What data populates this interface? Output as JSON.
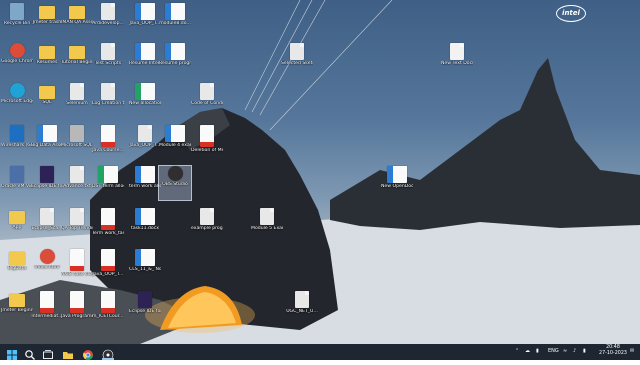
{
  "desktop": {
    "icons": [
      {
        "label": "Recycle Bin",
        "color": "#7fa7c8",
        "kind": "bin"
      },
      {
        "label": "Jmeter trash",
        "color": "#f2c94c",
        "kind": "folder"
      },
      {
        "label": "IMAN QA Assessmen...",
        "color": "#f2c94c",
        "kind": "folder"
      },
      {
        "label": "Ardidevelop...",
        "color": "#e8e8e8",
        "kind": "file"
      },
      {
        "label": "Java_OOP_T...",
        "color": "#2b7cd3",
        "kind": "docx"
      },
      {
        "label": "module8.do...",
        "color": "#2b7cd3",
        "kind": "docx"
      },
      {
        "label": "Google Chrome",
        "color": "#dd4b39",
        "kind": "round"
      },
      {
        "label": "Resumes",
        "color": "#f2c94c",
        "kind": "folder"
      },
      {
        "label": "Tutorial Beginner...",
        "color": "#f2c94c",
        "kind": "folder"
      },
      {
        "label": "Test Scripts",
        "color": "#e8e8e8",
        "kind": "file"
      },
      {
        "label": "Resume Interview...",
        "color": "#2b7cd3",
        "kind": "docx"
      },
      {
        "label": "Resume program f...",
        "color": "#2b7cd3",
        "kind": "docx"
      },
      {
        "label": "Microsoft Edge",
        "color": "#1fa3d6",
        "kind": "round"
      },
      {
        "label": "SQL",
        "color": "#f2c94c",
        "kind": "folder"
      },
      {
        "label": "Selenium",
        "color": "#e8e8e8",
        "kind": "file"
      },
      {
        "label": "Log Creation tool (build)...",
        "color": "#e8e8e8",
        "kind": "file"
      },
      {
        "label": "New allocations...",
        "color": "#21a366",
        "kind": "xlsx"
      },
      {
        "label": "Code of Conduct",
        "color": "#e8e8e8",
        "kind": "file"
      },
      {
        "label": "Wireshark (64-bit)",
        "color": "#1c6fc1",
        "kind": "app"
      },
      {
        "label": "Big Data Assessm...",
        "color": "#2b7cd3",
        "kind": "docx"
      },
      {
        "label": "Microsoft SQL Server...",
        "color": "#b8b8b8",
        "kind": "app"
      },
      {
        "label": "Java Course...",
        "color": "#d93025",
        "kind": "pdf"
      },
      {
        "label": "Java_OOP_T...",
        "color": "#e8e8e8",
        "kind": "file"
      },
      {
        "label": "Module 4 example pr...",
        "color": "#2b7cd3",
        "kind": "docx"
      },
      {
        "label": "Deletion of Member i...",
        "color": "#d93025",
        "kind": "pdf"
      },
      {
        "label": "Oracle VM VirtualBox",
        "color": "#4d6fa8",
        "kind": "app"
      },
      {
        "label": "Eclipse IDE for Java De...",
        "color": "#2c2255",
        "kind": "app"
      },
      {
        "label": "Advance.txt",
        "color": "#e8e8e8",
        "kind": "file"
      },
      {
        "label": "DST term allocations...",
        "color": "#21a366",
        "kind": "xlsx"
      },
      {
        "label": "term work allocation.d...",
        "color": "#2b7cd3",
        "kind": "docx"
      },
      {
        "label": "OBS Studio",
        "color": "#302e31",
        "kind": "round"
      },
      {
        "label": "New OpenDocu...",
        "color": "#2b7cd3",
        "kind": "docx"
      },
      {
        "label": "App",
        "color": "#f2c94c",
        "kind": "folder"
      },
      {
        "label": "Eclipse_Sca...",
        "color": "#e8e8e8",
        "kind": "file"
      },
      {
        "label": "QA Top Trending in...",
        "color": "#e8e8e8",
        "kind": "file"
      },
      {
        "label": "Term work_task.al...",
        "color": "#d93025",
        "kind": "pdf"
      },
      {
        "label": "task11.docx",
        "color": "#2b7cd3",
        "kind": "docx"
      },
      {
        "label": "example programs f...",
        "color": "#e8e8e8",
        "kind": "file"
      },
      {
        "label": "Module 5 Example pr...",
        "color": "#e8e8e8",
        "kind": "file"
      },
      {
        "label": "BigData",
        "color": "#f2c94c",
        "kind": "folder"
      },
      {
        "label": "index.html",
        "color": "#dd4b39",
        "kind": "round"
      },
      {
        "label": "AXIS case closur...",
        "color": "#d93025",
        "kind": "pdf"
      },
      {
        "label": "Java_OOP_T...",
        "color": "#d93025",
        "kind": "pdf"
      },
      {
        "label": "CLS_11_&_ Notes.docx",
        "color": "#2b7cd3",
        "kind": "docx"
      },
      {
        "label": "Jmeter Beginner",
        "color": "#f2c94c",
        "kind": "folder"
      },
      {
        "label": "Intermediat...",
        "color": "#d93025",
        "kind": "pdf"
      },
      {
        "label": "Java Programmin...",
        "color": "#d93025",
        "kind": "pdf"
      },
      {
        "label": "m_ICETCour... AP.pdf",
        "color": "#d93025",
        "kind": "pdf"
      },
      {
        "label": "Eclipse IDE for Eclipse...",
        "color": "#2c2255",
        "kind": "app"
      },
      {
        "label": "UGC_NET_U...",
        "color": "#e8e8e8",
        "kind": "file"
      },
      {
        "label": "Selected Sketch",
        "color": "#e8e8e8",
        "kind": "file"
      },
      {
        "label": "New Text Document.txt",
        "color": "#f2f2f2",
        "kind": "file"
      }
    ],
    "intel_logo": "intel"
  },
  "taskbar": {
    "apps": [
      "windows-start",
      "search",
      "task-view",
      "file-explorer",
      "chrome",
      "obs"
    ],
    "tray_lang": "ENG",
    "time": "20:48",
    "date": "27-10-2023"
  }
}
